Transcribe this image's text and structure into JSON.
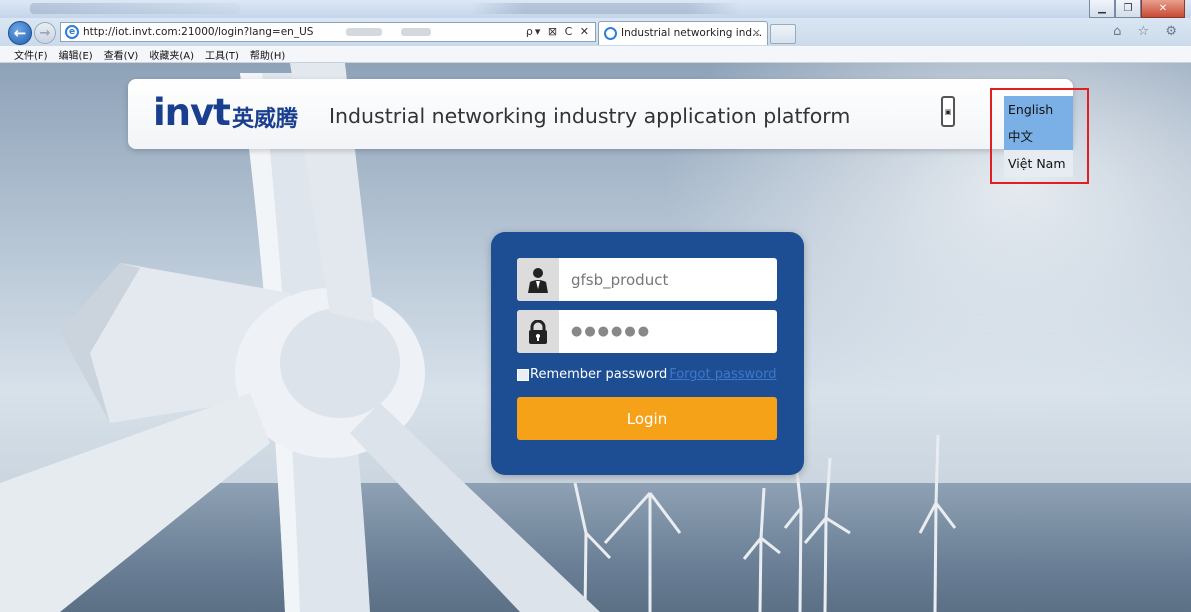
{
  "browser": {
    "url": "http://iot.invt.com:21000/login?lang=en_US",
    "tab_title": "Industrial networking ind...",
    "tab_close": "×",
    "address_tools": "ρ▾ ⊠ C ✕",
    "right_buttons": "⌂ ☆ ⚙",
    "menu": [
      "文件(F)",
      "编辑(E)",
      "查看(V)",
      "收藏夹(A)",
      "工具(T)",
      "帮助(H)"
    ]
  },
  "header": {
    "logo_en": "invt",
    "logo_cn": "英威腾",
    "title": "Industrial networking industry application platform"
  },
  "languages": [
    "English",
    "中文",
    "Việt Nam"
  ],
  "login": {
    "username": "gfsb_product",
    "password_mask": "●●●●●●",
    "remember_label": "Remember password",
    "forgot_label": "Forgot password",
    "login_label": "Login"
  },
  "colors": {
    "card": "#1d4e93",
    "login_button": "#f5a219",
    "logo": "#1a3f8f",
    "highlight": "#e02020"
  }
}
